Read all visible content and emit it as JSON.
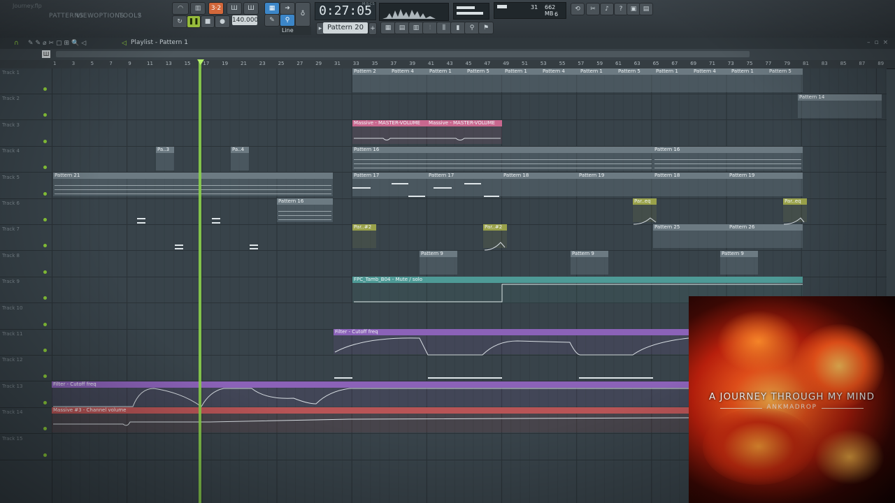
{
  "top": {
    "file_name": "Journey.flp",
    "menu": [
      "PATTERNS",
      "VIEW",
      "OPTIONS",
      "TOOLS",
      "?"
    ],
    "time": "0:27:05",
    "time_unit": "M:S:CS",
    "tempo": "140.000",
    "memory": "662 MB",
    "cpu": "31",
    "polyphony": "6",
    "pattern": "Pattern 20",
    "snap": "Line"
  },
  "playlist": {
    "title": "Playlist - Pattern 1",
    "ruler": [
      "1",
      "3",
      "5",
      "7",
      "9",
      "11",
      "13",
      "15",
      "17",
      "19",
      "21",
      "23",
      "25",
      "27",
      "29",
      "31",
      "33",
      "35",
      "37",
      "39",
      "41",
      "43",
      "45",
      "47",
      "49",
      "51",
      "53",
      "55",
      "57",
      "59",
      "61",
      "63",
      "65",
      "67",
      "69",
      "71",
      "73",
      "75",
      "77",
      "79",
      "81",
      "83",
      "85",
      "87",
      "89"
    ],
    "tracks": [
      "Track 1",
      "Track 2",
      "Track 3",
      "Track 4",
      "Track 5",
      "Track 6",
      "Track 7",
      "Track 8",
      "Track 9",
      "Track 10",
      "Track 11",
      "Track 12",
      "Track 13",
      "Track 14",
      "Track 15"
    ]
  },
  "clips": {
    "p2": "Pattern 2",
    "p4": "Pattern 4",
    "p1": "Pattern 1",
    "p5": "Pattern 5",
    "p14": "Pattern 14",
    "massive_vol": "Massive - MASTER-VOLUME",
    "p16": "Pattern 16",
    "pa3": "Pa..3",
    "pa4": "Pa..4",
    "p21": "Pattern 21",
    "p17": "Pattern 17",
    "p18": "Pattern 18",
    "p19": "Pattern 19",
    "pareq": "Par..eq",
    "par2": "Par..#2",
    "p25": "Pattern 25",
    "p26": "Pattern 26",
    "p9": "Pattern 9",
    "fpc": "FPC_Tamb_B04 - Mute / solo",
    "filter_cutoff": "Filter - Cutoff freq",
    "massive3": "Massive #3 - Channel volume"
  },
  "album": {
    "title": "A JOURNEY THROUGH MY MIND",
    "artist": "ANKMADROP"
  }
}
